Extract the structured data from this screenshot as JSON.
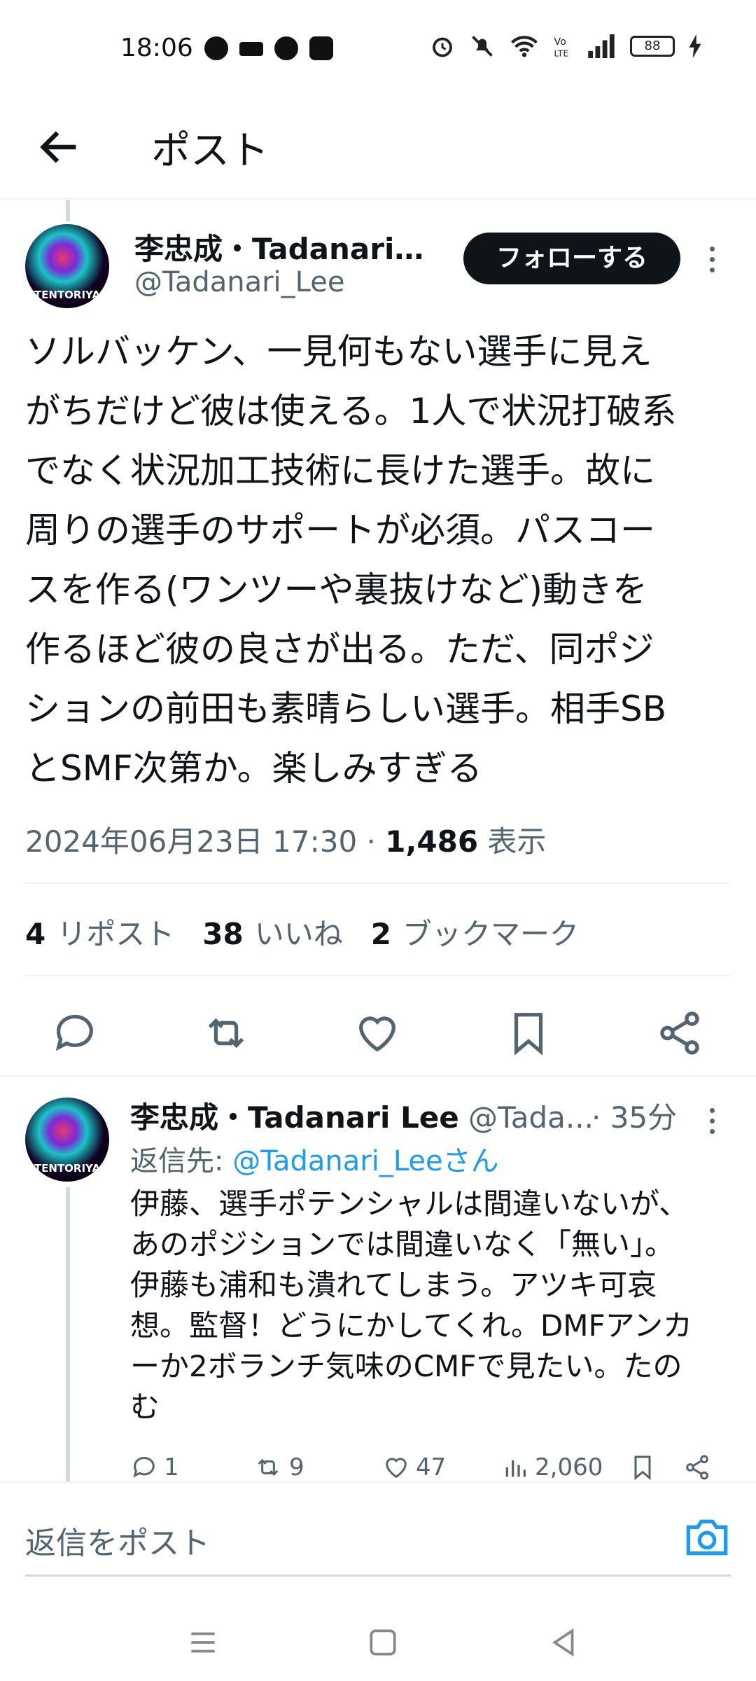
{
  "status_bar": {
    "time": "18:06",
    "battery": "88"
  },
  "header": {
    "title": "ポスト"
  },
  "tweet": {
    "author_name": "李忠成・Tadanari…",
    "author_handle": "@Tadanari_Lee",
    "avatar_text": "TENTORIYA",
    "follow_label": "フォローする",
    "body": "ソルバッケン、一見何もない選手に見え\nがちだけど彼は使える。1人で状況打破系\nでなく状況加工技術に長けた選手。故に\n周りの選手のサポートが必須。パスコー\nスを作る(ワンツーや裏抜けなど)動きを\n作るほど彼の良さが出る。ただ、同ポジ\nションの前田も素晴らしい選手。相手SB\nとSMF次第か。楽しみすぎる",
    "timestamp": "2024年06月23日 17:30 · ",
    "views_count": "1,486",
    "views_label": " 表示",
    "stats": {
      "reposts_count": "4",
      "reposts_label": "リポスト",
      "likes_count": "38",
      "likes_label": "いいね",
      "bookmarks_count": "2",
      "bookmarks_label": "ブックマーク"
    },
    "actions": [
      "reply-icon",
      "repost-icon",
      "like-icon",
      "bookmark-icon",
      "share-icon"
    ]
  },
  "reply": {
    "author_name": "李忠成・Tadanari Lee",
    "author_handle": " @Tada...",
    "time": "· 35分",
    "reply_to_prefix": "返信先: ",
    "reply_to_handle": "@Tadanari_Leeさん",
    "avatar_text": "TENTORIYA",
    "body": "伊藤、選手ポテンシャルは間違いないが、\nあのポジションでは間違いなく「無い」。\n伊藤も浦和も潰れてしまう。アツキ可哀\n想。監督！どうにかしてくれ。DMFアンカ\nーか2ボランチ気味のCMFで見たい。たの\nむ",
    "replies": "1",
    "reposts": "9",
    "likes": "47",
    "views": "2,060"
  },
  "compose": {
    "placeholder": "返信をポスト"
  },
  "colors": {
    "accent": "#1d9bf0",
    "text_primary": "#0f1419",
    "text_secondary": "#536471",
    "follow_bg": "#0f1419"
  }
}
